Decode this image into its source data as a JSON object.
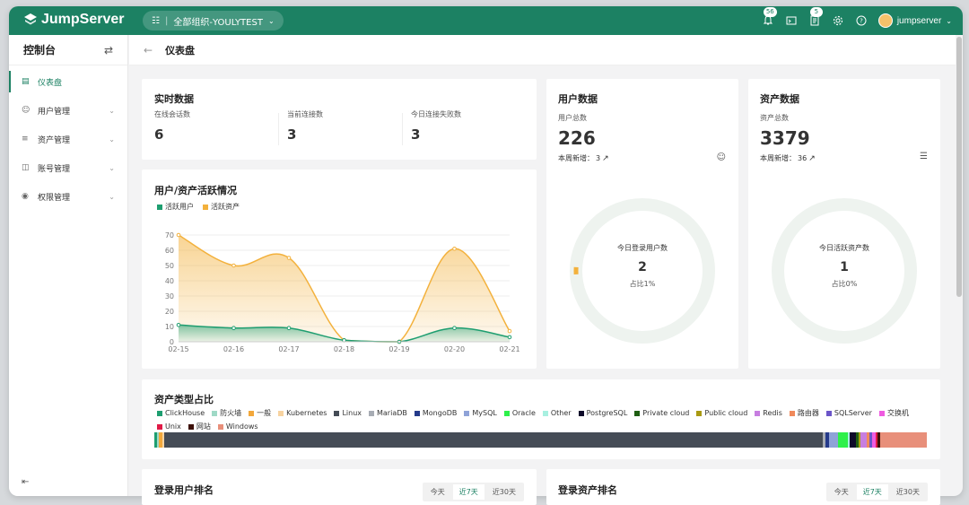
{
  "topbar": {
    "brand": "JumpServer",
    "org_label": "全部组织-YOULYTEST",
    "bell_badge": "56",
    "task_badge": "5",
    "username": "jumpserver"
  },
  "sidebar": {
    "title": "控制台",
    "items": [
      {
        "label": "仪表盘",
        "icon": "dashboard-icon"
      },
      {
        "label": "用户管理",
        "icon": "users-icon"
      },
      {
        "label": "资产管理",
        "icon": "assets-icon"
      },
      {
        "label": "账号管理",
        "icon": "accounts-icon"
      },
      {
        "label": "权限管理",
        "icon": "permission-icon"
      }
    ]
  },
  "page": {
    "title": "仪表盘"
  },
  "realtime": {
    "title": "实时数据",
    "stats": [
      {
        "label": "在线会话数",
        "value": "6"
      },
      {
        "label": "当前连接数",
        "value": "3"
      },
      {
        "label": "今日连接失败数",
        "value": "3"
      }
    ]
  },
  "user_data": {
    "title": "用户数据",
    "total_label": "用户总数",
    "total": "226",
    "weekly_label": "本周新增：",
    "weekly": "3",
    "donut_label": "今日登录用户数",
    "donut_value": "2",
    "donut_ratio": "占比1%",
    "ratio": 0.01
  },
  "asset_data": {
    "title": "资产数据",
    "total_label": "资产总数",
    "total": "3379",
    "weekly_label": "本周新增：",
    "weekly": "36",
    "donut_label": "今日活跃资产数",
    "donut_value": "1",
    "donut_ratio": "占比0%",
    "ratio": 0.0
  },
  "activity": {
    "title": "用户/资产活跃情况",
    "legend": [
      {
        "name": "活跃用户",
        "color": "#1e9e70"
      },
      {
        "name": "活跃资产",
        "color": "#f3b13c"
      }
    ]
  },
  "chart_data": {
    "type": "area",
    "x": [
      "02-15",
      "02-16",
      "02-17",
      "02-18",
      "02-19",
      "02-20",
      "02-21"
    ],
    "ylim": [
      0,
      70
    ],
    "yticks": [
      "0",
      "10",
      "20",
      "30",
      "40",
      "50",
      "60",
      "70"
    ],
    "series": [
      {
        "name": "活跃用户",
        "color": "#1e9e70",
        "values": [
          11,
          9,
          9,
          1,
          0,
          9,
          3
        ]
      },
      {
        "name": "活跃资产",
        "color": "#f3b13c",
        "values": [
          70,
          50,
          55,
          1,
          0,
          61,
          7
        ]
      }
    ]
  },
  "asset_types": {
    "title": "资产类型占比",
    "items": [
      {
        "name": "ClickHouse",
        "color": "#1e9e70",
        "share": 0.003
      },
      {
        "name": "防火墙",
        "color": "#9fd9c6",
        "share": 0.003
      },
      {
        "name": "一般",
        "color": "#f3a83b",
        "share": 0.004
      },
      {
        "name": "Kubernetes",
        "color": "#f7d3a0",
        "share": 0.003
      },
      {
        "name": "Linux",
        "color": "#454c56",
        "share": 0.848
      },
      {
        "name": "MariaDB",
        "color": "#a7acb4",
        "share": 0.003
      },
      {
        "name": "MongoDB",
        "color": "#253a8a",
        "share": 0.005
      },
      {
        "name": "MySQL",
        "color": "#8fa3d8",
        "share": 0.012
      },
      {
        "name": "Oracle",
        "color": "#2ef04a",
        "share": 0.012
      },
      {
        "name": "Other",
        "color": "#a8f0e0",
        "share": 0.003
      },
      {
        "name": "PostgreSQL",
        "color": "#0e0a2a",
        "share": 0.008
      },
      {
        "name": "Private cloud",
        "color": "#1e5e12",
        "share": 0.003
      },
      {
        "name": "Public cloud",
        "color": "#a99a12",
        "share": 0.003
      },
      {
        "name": "Redis",
        "color": "#c77ee0",
        "share": 0.008
      },
      {
        "name": "路由器",
        "color": "#f08a5b",
        "share": 0.003
      },
      {
        "name": "SQLServer",
        "color": "#6b55c8",
        "share": 0.004
      },
      {
        "name": "交换机",
        "color": "#ef5be0",
        "share": 0.004
      },
      {
        "name": "Unix",
        "color": "#e01a46",
        "share": 0.003
      },
      {
        "name": "网站",
        "color": "#3c1008",
        "share": 0.003
      },
      {
        "name": "Windows",
        "color": "#e88f7a",
        "share": 0.06
      }
    ]
  },
  "login_users": {
    "title": "登录用户排名",
    "tabs": [
      "今天",
      "近7天",
      "近30天"
    ],
    "active_tab": 1
  },
  "login_assets": {
    "title": "登录资产排名",
    "tabs": [
      "今天",
      "近7天",
      "近30天"
    ],
    "active_tab": 1
  }
}
